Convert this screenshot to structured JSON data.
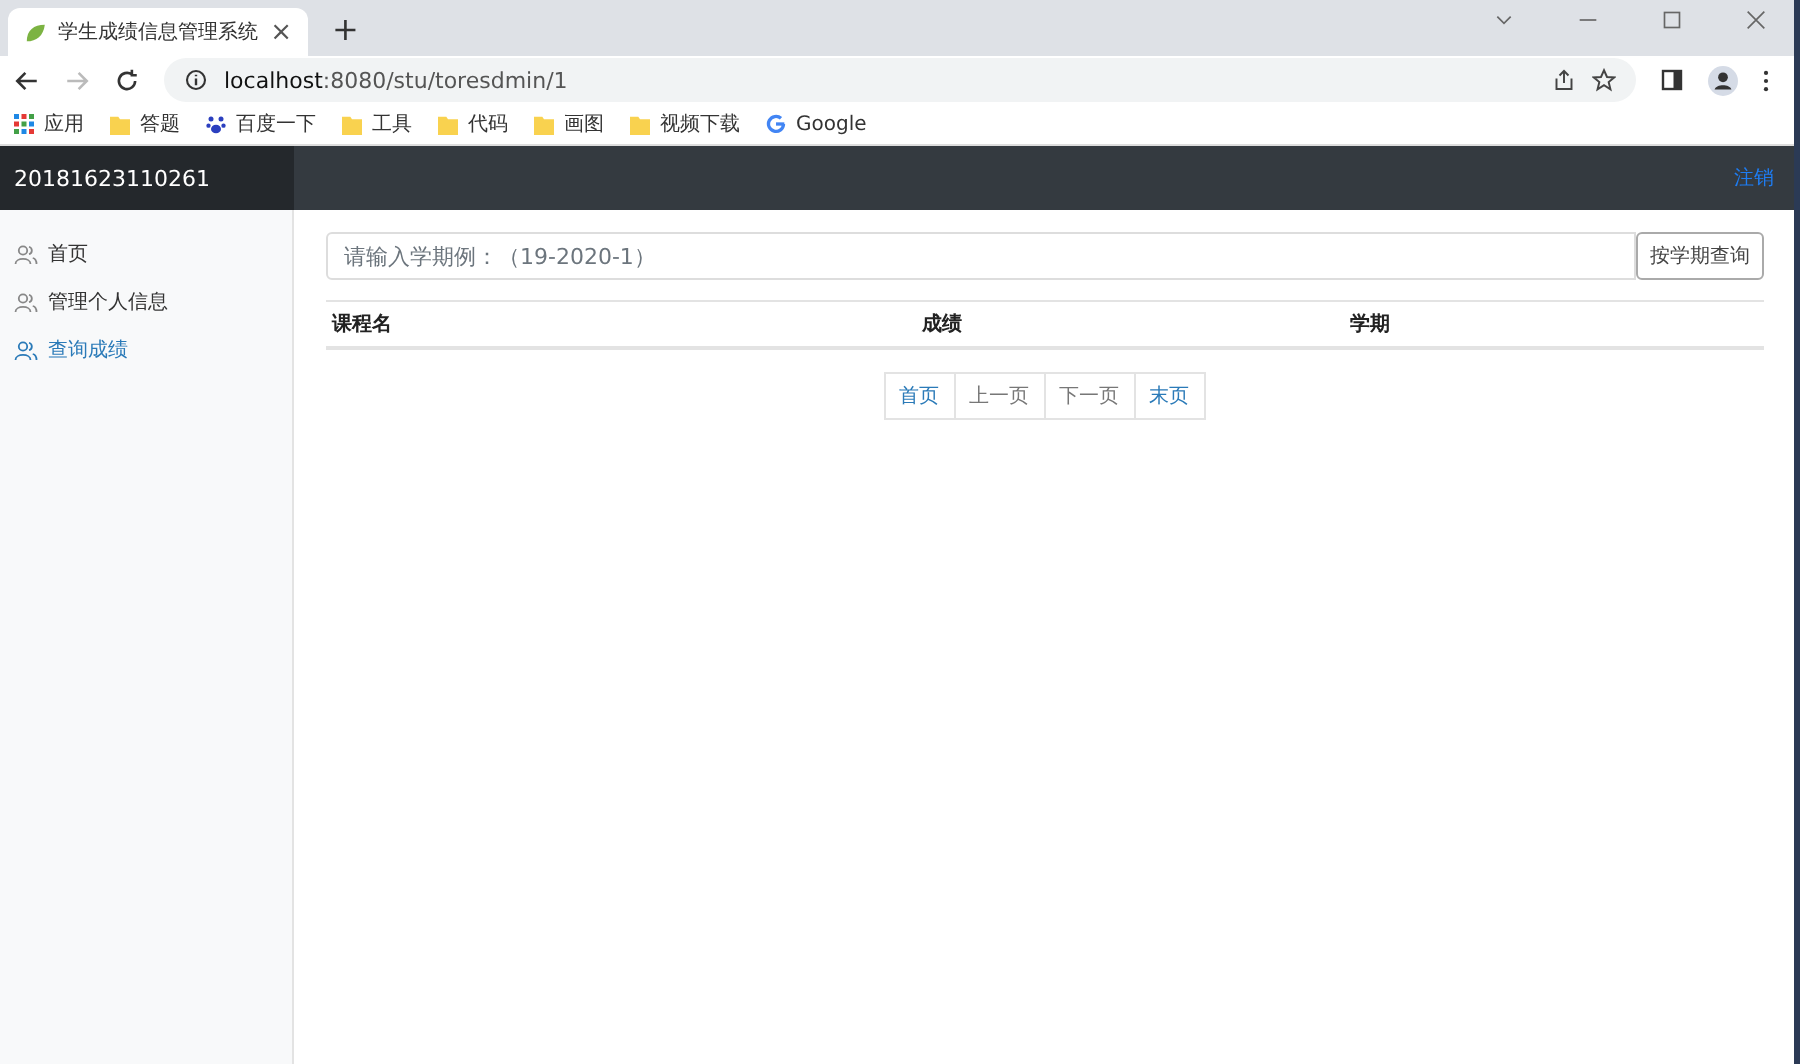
{
  "browser": {
    "tab": {
      "title": "学生成绩信息管理系统",
      "close": "×"
    },
    "new_tab": "+",
    "url": "**localhost**:8080/stu/toresdmin/1",
    "bookmarks": [
      {
        "label": "应用",
        "kind": "apps"
      },
      {
        "label": "答题",
        "kind": "folder"
      },
      {
        "label": "百度一下",
        "kind": "paw"
      },
      {
        "label": "工具",
        "kind": "folder"
      },
      {
        "label": "代码",
        "kind": "folder"
      },
      {
        "label": "画图",
        "kind": "folder"
      },
      {
        "label": "视频下载",
        "kind": "folder"
      },
      {
        "label": "Google",
        "kind": "google"
      }
    ]
  },
  "header": {
    "user_id": "20181623110261",
    "logout": "注销"
  },
  "sidebar": {
    "items": [
      {
        "label": "首页",
        "selected": false
      },
      {
        "label": "管理个人信息",
        "selected": false
      },
      {
        "label": "查询成绩",
        "selected": true
      }
    ]
  },
  "search": {
    "placeholder": "请输入学期例：（19-2020-1）",
    "button": "按学期查询"
  },
  "table": {
    "columns": [
      "课程名",
      "成绩",
      "学期"
    ]
  },
  "pagination": [
    {
      "label": "首页",
      "disabled": false
    },
    {
      "label": "上一页",
      "disabled": true
    },
    {
      "label": "下一页",
      "disabled": true
    },
    {
      "label": "末页",
      "disabled": false
    }
  ]
}
